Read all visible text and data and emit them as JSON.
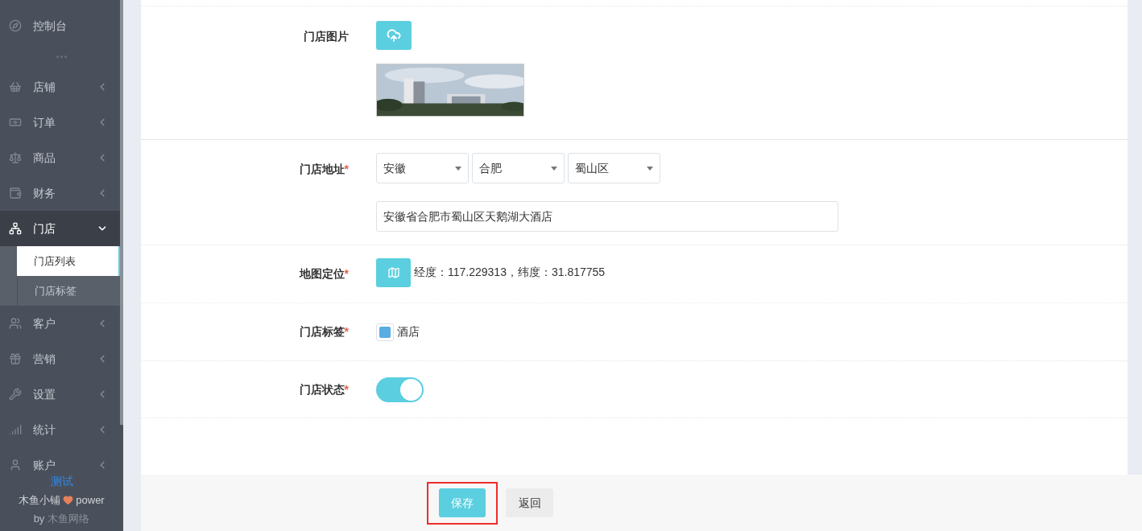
{
  "sidebar": {
    "items": [
      {
        "label": "控制台",
        "kind": "plain",
        "expanded": false
      },
      {
        "label": "店铺",
        "kind": "group",
        "expanded": false
      },
      {
        "label": "订单",
        "kind": "group",
        "expanded": false
      },
      {
        "label": "商品",
        "kind": "group",
        "expanded": false
      },
      {
        "label": "财务",
        "kind": "group",
        "expanded": false
      },
      {
        "label": "门店",
        "kind": "group",
        "expanded": true,
        "children": [
          {
            "label": "门店列表",
            "selected": true
          },
          {
            "label": "门店标签",
            "selected": false
          }
        ]
      },
      {
        "label": "客户",
        "kind": "group",
        "expanded": false
      },
      {
        "label": "营销",
        "kind": "group",
        "expanded": false
      },
      {
        "label": "设置",
        "kind": "group",
        "expanded": false
      },
      {
        "label": "统计",
        "kind": "group",
        "expanded": false
      },
      {
        "label": "账户",
        "kind": "group",
        "expanded": false
      }
    ],
    "footer": {
      "name": "测试",
      "brand": "木鱼小铺",
      "power": "power",
      "by": "by",
      "company": "木鱼网络"
    }
  },
  "form": {
    "rows": [
      {
        "label": "门店图片"
      },
      {
        "kind": "address",
        "label": "门店地址",
        "mark": "*",
        "province": "安徽",
        "city": "合肥",
        "district": "蜀山区",
        "detail": "安徽省合肥市蜀山区天鹅湖大酒店"
      },
      {
        "kind": "map",
        "label": "地图定位",
        "mark": "*",
        "coords": "经度：117.229313，纬度：31.817755"
      },
      {
        "kind": "tags",
        "label": "门店标签",
        "mark": "*",
        "tags": [
          {
            "label": "酒店",
            "checked": true
          }
        ]
      },
      {
        "kind": "switch",
        "label": "门店状态",
        "mark": "*",
        "on": true
      }
    ]
  },
  "buttons": {
    "save": "保存",
    "back": "返回"
  }
}
